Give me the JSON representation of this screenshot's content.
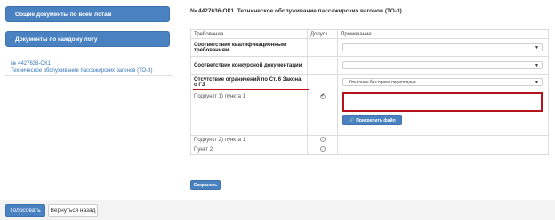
{
  "sidebar": {
    "all_docs_label": "Общие документы по всем лотам",
    "lot_docs_label": "Документы по каждому лоту",
    "lot_link_line1": "№ 4427636-ОК1",
    "lot_link_line2": "Техническое обслуживание пассажирских вагонов (ТО-3)"
  },
  "main": {
    "title": "№ 4427636-ОК1. Техническое обслуживание пассажирских вагонов (ТО-3)",
    "table": {
      "headers": [
        "Требования",
        "Допуск",
        "Примечание"
      ],
      "rows": [
        {
          "label": "Соответствие квалификационным требованиям",
          "select": ""
        },
        {
          "label": "Соответствие конкурсной документации",
          "select": ""
        },
        {
          "label": "Отсутствие ограничений по Ст. 6 Закона о ГЗ",
          "select": "Отклонен без права переподачи"
        },
        {
          "label": "Подпункт 1) пункта 1",
          "attach_label": "Прикрепить файл"
        },
        {
          "label": "Подпункт 2) пункта 1"
        },
        {
          "label": "Пункт 2"
        }
      ]
    },
    "save_label": "Сохранить"
  },
  "footer": {
    "vote_label": "Голосовать",
    "back_label": "Вернуться назад"
  },
  "colors": {
    "accent": "#4a82c1",
    "highlight": "#b5121b"
  }
}
